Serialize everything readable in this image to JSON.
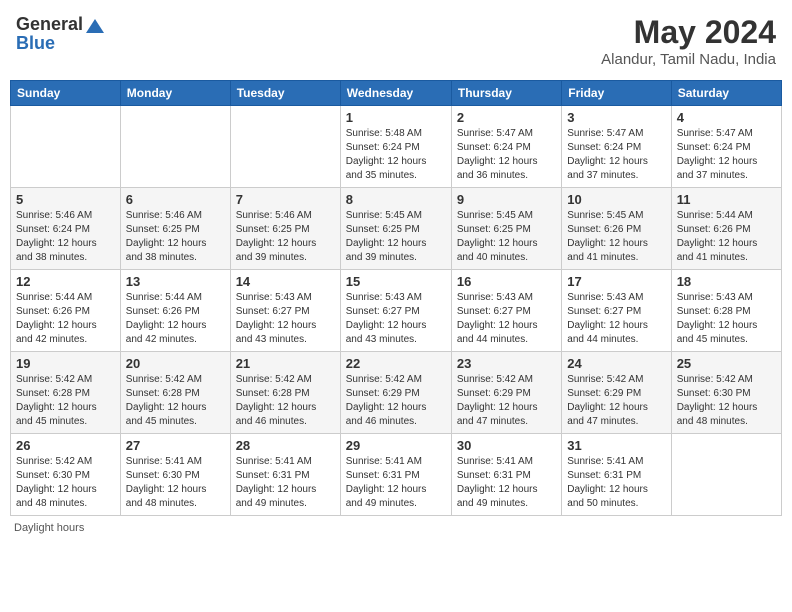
{
  "header": {
    "logo_general": "General",
    "logo_blue": "Blue",
    "title": "May 2024",
    "location": "Alandur, Tamil Nadu, India"
  },
  "calendar": {
    "days_of_week": [
      "Sunday",
      "Monday",
      "Tuesday",
      "Wednesday",
      "Thursday",
      "Friday",
      "Saturday"
    ],
    "weeks": [
      [
        {
          "day": "",
          "info": ""
        },
        {
          "day": "",
          "info": ""
        },
        {
          "day": "",
          "info": ""
        },
        {
          "day": "1",
          "info": "Sunrise: 5:48 AM\nSunset: 6:24 PM\nDaylight: 12 hours\nand 35 minutes."
        },
        {
          "day": "2",
          "info": "Sunrise: 5:47 AM\nSunset: 6:24 PM\nDaylight: 12 hours\nand 36 minutes."
        },
        {
          "day": "3",
          "info": "Sunrise: 5:47 AM\nSunset: 6:24 PM\nDaylight: 12 hours\nand 37 minutes."
        },
        {
          "day": "4",
          "info": "Sunrise: 5:47 AM\nSunset: 6:24 PM\nDaylight: 12 hours\nand 37 minutes."
        }
      ],
      [
        {
          "day": "5",
          "info": "Sunrise: 5:46 AM\nSunset: 6:24 PM\nDaylight: 12 hours\nand 38 minutes."
        },
        {
          "day": "6",
          "info": "Sunrise: 5:46 AM\nSunset: 6:25 PM\nDaylight: 12 hours\nand 38 minutes."
        },
        {
          "day": "7",
          "info": "Sunrise: 5:46 AM\nSunset: 6:25 PM\nDaylight: 12 hours\nand 39 minutes."
        },
        {
          "day": "8",
          "info": "Sunrise: 5:45 AM\nSunset: 6:25 PM\nDaylight: 12 hours\nand 39 minutes."
        },
        {
          "day": "9",
          "info": "Sunrise: 5:45 AM\nSunset: 6:25 PM\nDaylight: 12 hours\nand 40 minutes."
        },
        {
          "day": "10",
          "info": "Sunrise: 5:45 AM\nSunset: 6:26 PM\nDaylight: 12 hours\nand 41 minutes."
        },
        {
          "day": "11",
          "info": "Sunrise: 5:44 AM\nSunset: 6:26 PM\nDaylight: 12 hours\nand 41 minutes."
        }
      ],
      [
        {
          "day": "12",
          "info": "Sunrise: 5:44 AM\nSunset: 6:26 PM\nDaylight: 12 hours\nand 42 minutes."
        },
        {
          "day": "13",
          "info": "Sunrise: 5:44 AM\nSunset: 6:26 PM\nDaylight: 12 hours\nand 42 minutes."
        },
        {
          "day": "14",
          "info": "Sunrise: 5:43 AM\nSunset: 6:27 PM\nDaylight: 12 hours\nand 43 minutes."
        },
        {
          "day": "15",
          "info": "Sunrise: 5:43 AM\nSunset: 6:27 PM\nDaylight: 12 hours\nand 43 minutes."
        },
        {
          "day": "16",
          "info": "Sunrise: 5:43 AM\nSunset: 6:27 PM\nDaylight: 12 hours\nand 44 minutes."
        },
        {
          "day": "17",
          "info": "Sunrise: 5:43 AM\nSunset: 6:27 PM\nDaylight: 12 hours\nand 44 minutes."
        },
        {
          "day": "18",
          "info": "Sunrise: 5:43 AM\nSunset: 6:28 PM\nDaylight: 12 hours\nand 45 minutes."
        }
      ],
      [
        {
          "day": "19",
          "info": "Sunrise: 5:42 AM\nSunset: 6:28 PM\nDaylight: 12 hours\nand 45 minutes."
        },
        {
          "day": "20",
          "info": "Sunrise: 5:42 AM\nSunset: 6:28 PM\nDaylight: 12 hours\nand 45 minutes."
        },
        {
          "day": "21",
          "info": "Sunrise: 5:42 AM\nSunset: 6:28 PM\nDaylight: 12 hours\nand 46 minutes."
        },
        {
          "day": "22",
          "info": "Sunrise: 5:42 AM\nSunset: 6:29 PM\nDaylight: 12 hours\nand 46 minutes."
        },
        {
          "day": "23",
          "info": "Sunrise: 5:42 AM\nSunset: 6:29 PM\nDaylight: 12 hours\nand 47 minutes."
        },
        {
          "day": "24",
          "info": "Sunrise: 5:42 AM\nSunset: 6:29 PM\nDaylight: 12 hours\nand 47 minutes."
        },
        {
          "day": "25",
          "info": "Sunrise: 5:42 AM\nSunset: 6:30 PM\nDaylight: 12 hours\nand 48 minutes."
        }
      ],
      [
        {
          "day": "26",
          "info": "Sunrise: 5:42 AM\nSunset: 6:30 PM\nDaylight: 12 hours\nand 48 minutes."
        },
        {
          "day": "27",
          "info": "Sunrise: 5:41 AM\nSunset: 6:30 PM\nDaylight: 12 hours\nand 48 minutes."
        },
        {
          "day": "28",
          "info": "Sunrise: 5:41 AM\nSunset: 6:31 PM\nDaylight: 12 hours\nand 49 minutes."
        },
        {
          "day": "29",
          "info": "Sunrise: 5:41 AM\nSunset: 6:31 PM\nDaylight: 12 hours\nand 49 minutes."
        },
        {
          "day": "30",
          "info": "Sunrise: 5:41 AM\nSunset: 6:31 PM\nDaylight: 12 hours\nand 49 minutes."
        },
        {
          "day": "31",
          "info": "Sunrise: 5:41 AM\nSunset: 6:31 PM\nDaylight: 12 hours\nand 50 minutes."
        },
        {
          "day": "",
          "info": ""
        }
      ]
    ]
  },
  "footer": {
    "text": "Daylight hours"
  }
}
